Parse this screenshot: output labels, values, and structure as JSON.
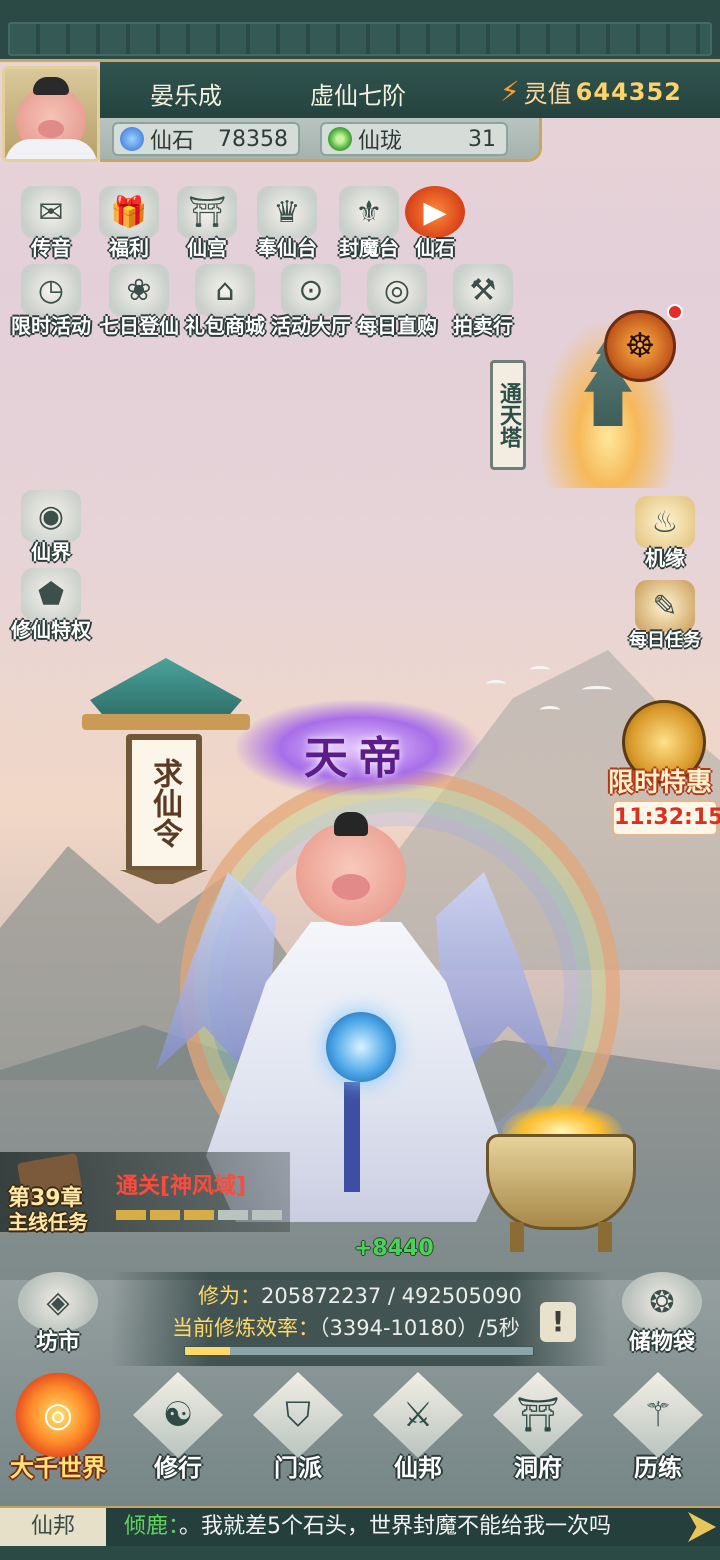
{
  "player": {
    "name": "晏乐成",
    "rank": "虚仙七阶",
    "lingzhi_label": "灵值",
    "lingzhi_value": "644352"
  },
  "currencies": [
    {
      "label": "仙石",
      "value": "78358",
      "icon": "blue-gem-icon",
      "color": "#3d7ee8"
    },
    {
      "label": "仙珑",
      "value": "31",
      "icon": "jade-ring-icon",
      "color": "#4caf3a"
    }
  ],
  "top_row1": [
    {
      "label": "传音",
      "icon": "letter-icon",
      "glyph": "✉"
    },
    {
      "label": "福利",
      "icon": "gift-icon",
      "glyph": "🎁"
    },
    {
      "label": "仙宫",
      "icon": "palace-icon",
      "glyph": "⛩"
    },
    {
      "label": "奉仙台",
      "icon": "altar-icon",
      "glyph": "♛"
    },
    {
      "label": "封魔台",
      "icon": "seal-altar-icon",
      "glyph": "⚜"
    },
    {
      "label": "仙石",
      "icon": "play-icon",
      "glyph": "▶"
    }
  ],
  "top_row2": [
    {
      "label": "限时活动",
      "icon": "clock-icon",
      "glyph": "◷"
    },
    {
      "label": "七日登仙",
      "icon": "lotus-icon",
      "glyph": "❀"
    },
    {
      "label": "礼包商城",
      "icon": "shop-icon",
      "glyph": "⌂"
    },
    {
      "label": "活动大厅",
      "icon": "hall-icon",
      "glyph": "⊙"
    },
    {
      "label": "每日直购",
      "icon": "coin-icon",
      "glyph": "◎"
    },
    {
      "label": "拍卖行",
      "icon": "gavel-icon",
      "glyph": "⚒"
    }
  ],
  "left_side": [
    {
      "label": "仙界",
      "icon": "swirl-icon",
      "glyph": "◉"
    },
    {
      "label": "修仙特权",
      "icon": "turtle-icon",
      "glyph": "⬟"
    }
  ],
  "right_side": [
    {
      "label": "机缘",
      "icon": "gourd-icon",
      "glyph": "♨"
    },
    {
      "label": "每日任务",
      "icon": "scroll-icon",
      "glyph": "✎"
    }
  ],
  "tower_label": "通天塔",
  "limited": {
    "label": "限时特惠",
    "timer": "11:32:15"
  },
  "qiuxianling": "求仙令",
  "title_badge": "天帝",
  "chapter": {
    "chapter_label": "第39章",
    "main_task": "主线任务",
    "task_name": "通关[神风域]",
    "progress_segments": 5,
    "progress_done": 3
  },
  "gain": "+8440",
  "cultivation": {
    "xiuwei_label": "修为：",
    "xiuwei_value": "205872237 / 492505090",
    "rate_label": "当前修炼效率：",
    "rate_value": "（3394-10180）/5秒",
    "progress_fraction": 0.13
  },
  "side_low": [
    {
      "label": "坊市",
      "icon": "market-icon",
      "glyph": "◈"
    },
    {
      "label": "储物袋",
      "icon": "bag-icon",
      "glyph": "❂"
    }
  ],
  "nav": [
    {
      "label": "大千世界",
      "icon": "world-icon",
      "glyph": "◎",
      "active": true
    },
    {
      "label": "修行",
      "icon": "cultivate-icon",
      "glyph": "☯",
      "active": false
    },
    {
      "label": "门派",
      "icon": "sect-icon",
      "glyph": "⛉",
      "active": false
    },
    {
      "label": "仙邦",
      "icon": "alliance-icon",
      "glyph": "⚔",
      "active": false
    },
    {
      "label": "洞府",
      "icon": "cave-icon",
      "glyph": "⛩",
      "active": false
    },
    {
      "label": "历练",
      "icon": "training-icon",
      "glyph": "⚚",
      "active": false
    }
  ],
  "chat": {
    "channel": "仙邦",
    "sender": "倾鹿：",
    "message": "。我就差5个石头，世界封魔不能给我一次吗"
  }
}
